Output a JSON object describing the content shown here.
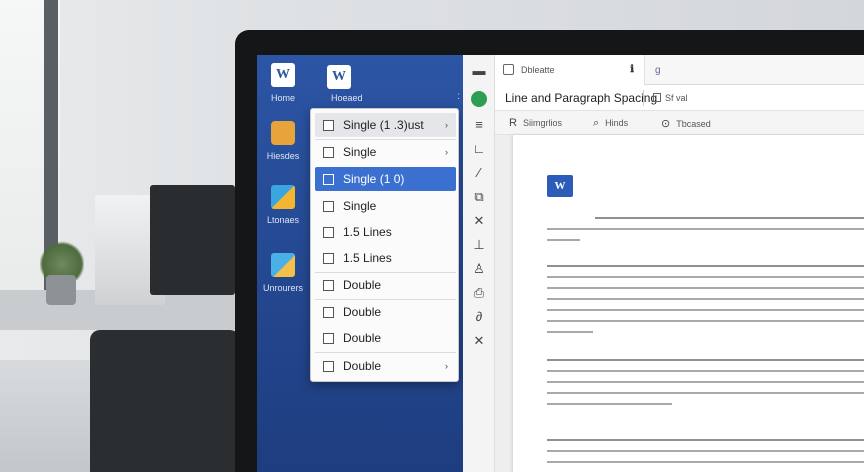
{
  "sidebar": {
    "items": [
      {
        "label": "Home",
        "icon": "word-icon"
      },
      {
        "label": "Hiesdes",
        "icon": "chat-icon"
      },
      {
        "label": "Ltonaes",
        "icon": "document-icon"
      },
      {
        "label": "Unrourers",
        "icon": "upload-icon"
      }
    ]
  },
  "pane": {
    "icon": "word-icon",
    "label": "Hoeaed",
    "dots": ":"
  },
  "spacing_menu": {
    "items": [
      {
        "label": "Single (1 .3)ust",
        "has_submenu": true,
        "state": "hover"
      },
      {
        "label": "Single",
        "has_submenu": true
      },
      {
        "label": "Single (1 0)",
        "selected": true
      },
      {
        "label": "Single"
      },
      {
        "label": "1.5 Lines"
      },
      {
        "label": "1.5 Lines"
      },
      {
        "label": "Double"
      },
      {
        "label": "Double"
      },
      {
        "label": "Double"
      },
      {
        "label": "Double",
        "has_submenu": true
      }
    ]
  },
  "tab": {
    "title": "Dbleatte",
    "close": "ℹ",
    "extra": "g"
  },
  "ribbon": {
    "title": "Line and Paragraph Spacing",
    "option": "Sf val"
  },
  "toolbar": {
    "buttons": [
      {
        "glyph": "R",
        "label": "Siimgrlios"
      },
      {
        "glyph": "⌕",
        "label": "Hinds"
      },
      {
        "glyph": "⊙",
        "label": "Tbcased"
      }
    ]
  },
  "document": {
    "icon": "word-icon"
  },
  "colors": {
    "word_blue": "#2b579a",
    "selected": "#3b6fd0",
    "green_tool": "#2e9e55"
  }
}
